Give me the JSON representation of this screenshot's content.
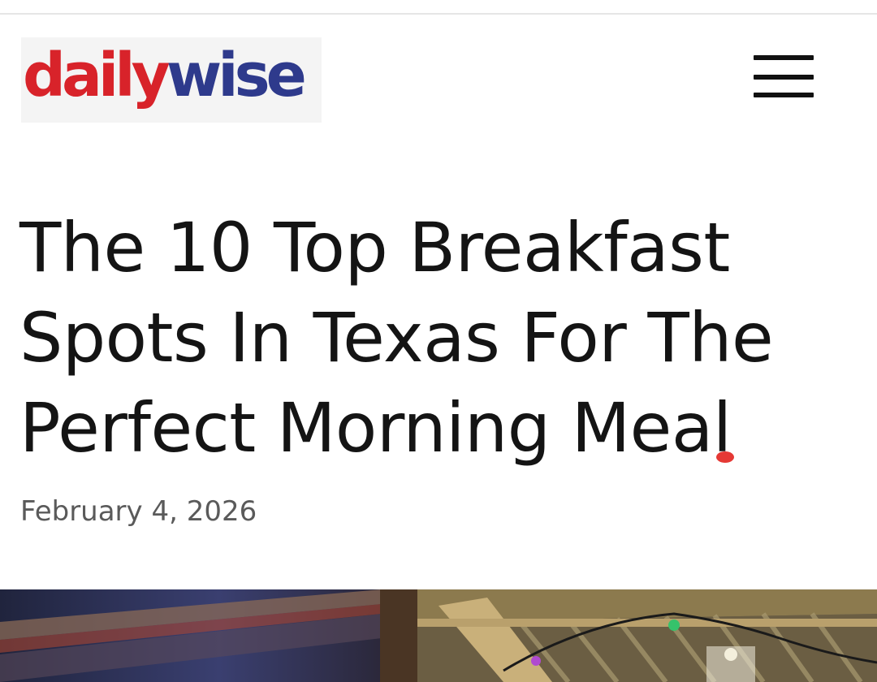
{
  "header": {
    "logo": {
      "part1": "daily",
      "part2": "wise"
    },
    "menu_icon": "hamburger-menu-icon"
  },
  "article": {
    "title": "The 10 Top Breakfast Spots In Texas For The Perfect Morning Meal",
    "date": "February 4, 2026"
  },
  "colors": {
    "logo_red": "#d8232a",
    "logo_blue": "#2e3a8c",
    "headline": "#141414",
    "dateline": "#5a5a5a"
  }
}
